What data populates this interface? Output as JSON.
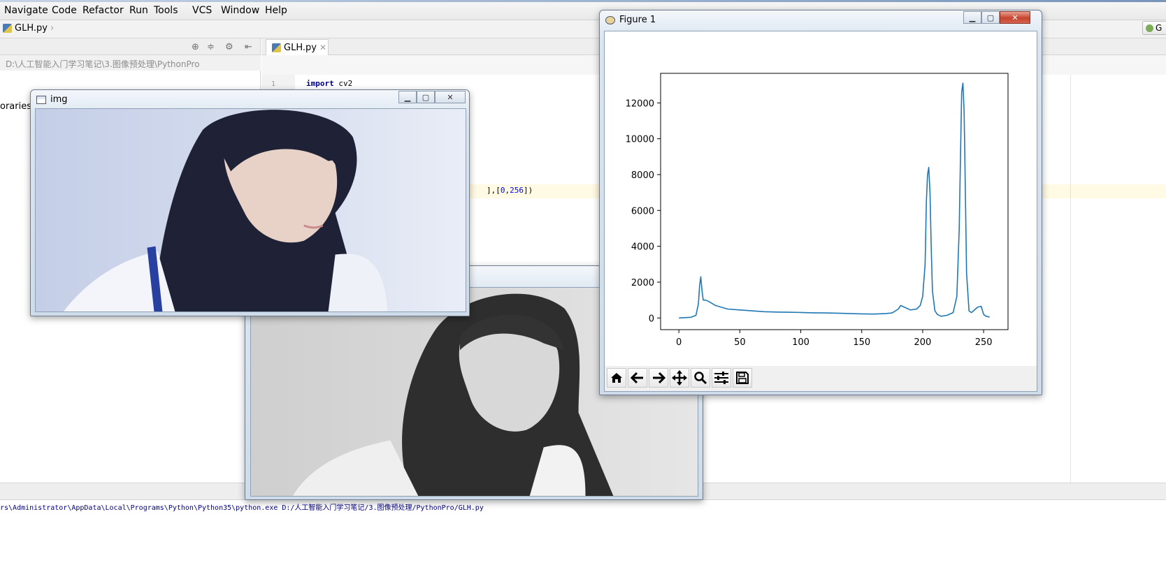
{
  "menubar": {
    "items": [
      "Navigate",
      "Code",
      "Refactor",
      "Run",
      "Tools",
      "VCS",
      "Window",
      "Help"
    ]
  },
  "navbar": {
    "file": "GLH.py",
    "right_button": "G"
  },
  "project": {
    "path": "D:\\人工智能入门学习笔记\\3.图像预处理\\PythonPro",
    "libraries_label": "oraries"
  },
  "editor": {
    "tab_label": "GLH.py",
    "line_number": "1",
    "keyword": "import",
    "module": " cv2",
    "fragment_a": "],[",
    "fragment_n1": "0",
    "fragment_b": ",",
    "fragment_n2": "256",
    "fragment_c": "])"
  },
  "console": {
    "command": "rs\\Administrator\\AppData\\Local\\Programs\\Python\\Python35\\python.exe D:/人工智能入门学习笔记/3.图像预处理/PythonPro/GLH.py"
  },
  "img_window": {
    "title": "img"
  },
  "figure_window": {
    "title": "Figure 1",
    "toolbar": [
      "home-icon",
      "back-icon",
      "forward-icon",
      "pan-icon",
      "zoom-icon",
      "configure-subplots-icon",
      "save-icon"
    ]
  },
  "colors": {
    "series": "#1f77b4",
    "highlight_line": "#fffae3",
    "console_text": "#000080"
  },
  "chart_data": {
    "type": "line",
    "title": "",
    "xlabel": "",
    "ylabel": "",
    "xlim": [
      -15,
      270
    ],
    "ylim": [
      -650,
      13650
    ],
    "x_ticks": [
      0,
      50,
      100,
      150,
      200,
      250
    ],
    "y_ticks": [
      0,
      2000,
      4000,
      6000,
      8000,
      10000,
      12000
    ],
    "grid": false,
    "series": [
      {
        "x": [
          0,
          5,
          10,
          14,
          16,
          17,
          18,
          19,
          20,
          22,
          25,
          30,
          40,
          50,
          60,
          70,
          80,
          90,
          100,
          110,
          120,
          130,
          140,
          150,
          160,
          170,
          175,
          180,
          182,
          185,
          190,
          195,
          198,
          200,
          202,
          203,
          204,
          205,
          206,
          207,
          208,
          210,
          212,
          215,
          220,
          225,
          228,
          230,
          231,
          232,
          233,
          234,
          235,
          236,
          238,
          240,
          245,
          248,
          250,
          252,
          255
        ],
        "y": [
          0,
          20,
          40,
          150,
          800,
          1800,
          2300,
          1500,
          1000,
          1000,
          900,
          700,
          500,
          450,
          400,
          350,
          330,
          320,
          310,
          290,
          280,
          270,
          250,
          230,
          220,
          250,
          280,
          500,
          700,
          600,
          450,
          500,
          700,
          1200,
          3000,
          6500,
          8000,
          8400,
          7000,
          4000,
          1500,
          400,
          200,
          100,
          150,
          300,
          1200,
          5000,
          9000,
          12600,
          13100,
          11500,
          7000,
          2500,
          400,
          300,
          600,
          650,
          200,
          100,
          50
        ]
      }
    ]
  }
}
